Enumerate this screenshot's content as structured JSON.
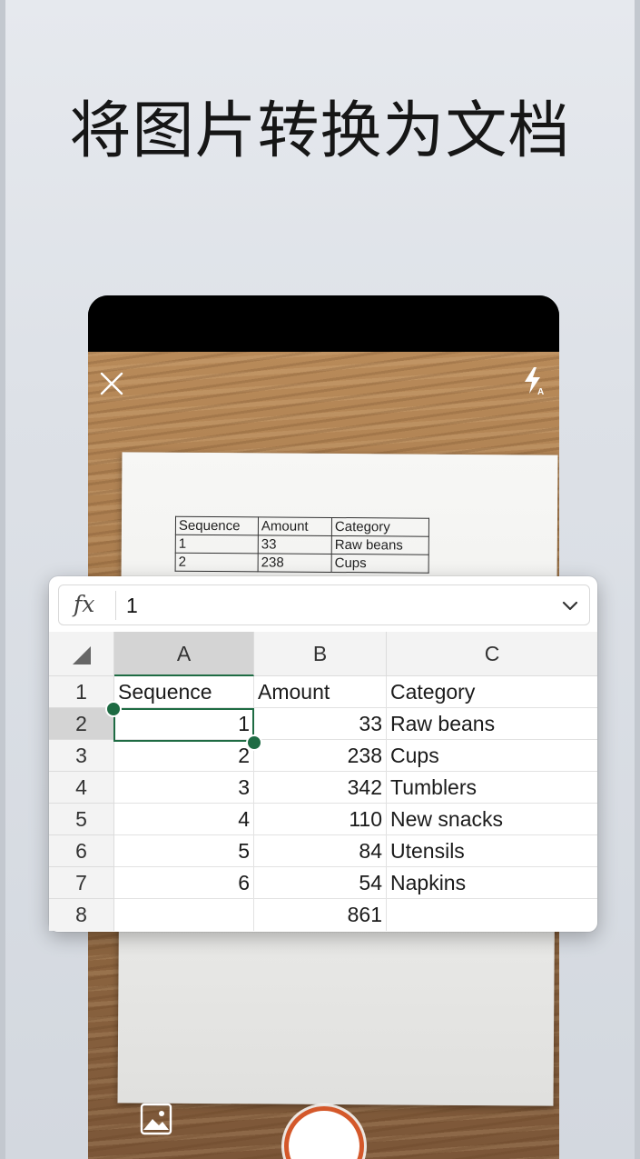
{
  "headline": "将图片转换为文档",
  "camera": {
    "close_icon": "close-icon",
    "flash_icon": "flash-auto-icon",
    "gallery_icon": "image-gallery-icon",
    "shutter_icon": "shutter-button",
    "accent_color": "#d4582a"
  },
  "paper_table": {
    "rows": [
      [
        "Sequence",
        "Amount",
        "Category"
      ],
      [
        "1",
        "33",
        "Raw beans"
      ],
      [
        "2",
        "238",
        "Cups"
      ]
    ]
  },
  "formula_bar": {
    "fx_label": "fx",
    "value": "1"
  },
  "sheet": {
    "columns": [
      "A",
      "B",
      "C"
    ],
    "rows": [
      {
        "num": "1",
        "a": "Sequence",
        "b": "Amount",
        "c": "Category"
      },
      {
        "num": "2",
        "a": "1",
        "b": "33",
        "c": "Raw beans"
      },
      {
        "num": "3",
        "a": "2",
        "b": "238",
        "c": "Cups"
      },
      {
        "num": "4",
        "a": "3",
        "b": "342",
        "c": "Tumblers"
      },
      {
        "num": "5",
        "a": "4",
        "b": "110",
        "c": "New snacks"
      },
      {
        "num": "6",
        "a": "5",
        "b": "84",
        "c": "Utensils"
      },
      {
        "num": "7",
        "a": "6",
        "b": "54",
        "c": "Napkins"
      },
      {
        "num": "8",
        "a": "",
        "b": "861",
        "c": ""
      }
    ],
    "selected_cell": "A2",
    "selection_color": "#1e6b43"
  }
}
